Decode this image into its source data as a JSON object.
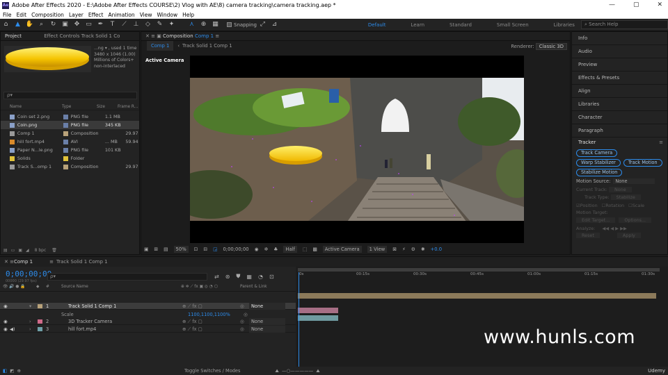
{
  "titlebar": {
    "title": "Adobe After Effects 2020 - E:\\Adobe After Effects COURSE\\2) Vlog with AE\\8) camera tracking\\camera tracking.aep *",
    "logo": "Ae"
  },
  "menu": [
    "File",
    "Edit",
    "Composition",
    "Layer",
    "Effect",
    "Animation",
    "View",
    "Window",
    "Help"
  ],
  "toolbar": {
    "snapping_label": "Snapping",
    "workspaces": [
      "Default",
      "Learn",
      "Standard",
      "Small Screen",
      "Libraries"
    ],
    "active_workspace": "Default",
    "search_placeholder": "Search Help"
  },
  "project": {
    "tab_project": "Project",
    "tab_effect_controls": "Effect Controls Track Solid 1 Co",
    "info_lines": [
      "...ng ▾ , used 1 time",
      "3480 x 1046 (1.00)",
      "",
      "Millions of Colors+",
      "non-interlaced"
    ],
    "search_placeholder": "ρ▾",
    "columns": [
      "Name",
      "Type",
      "Size",
      "Frame R..."
    ],
    "items": [
      {
        "name": "Coin set 2.png",
        "type": "PNG file",
        "size": "1.1 MB",
        "fps": "",
        "swatch": "#6a7fa8",
        "icon": "#8aa0c8",
        "selected": false
      },
      {
        "name": "Coin.png",
        "type": "PNG file",
        "size": "345 KB",
        "fps": "",
        "swatch": "#6a7fa8",
        "icon": "#8aa0c8",
        "selected": true
      },
      {
        "name": "Comp 1",
        "type": "Composition",
        "size": "",
        "fps": "29.97",
        "swatch": "#b8a27a",
        "icon": "#9a9a9a",
        "selected": false
      },
      {
        "name": "hill fort.mp4",
        "type": "AVI",
        "size": "... MB",
        "fps": "59.94",
        "swatch": "#6a7fa8",
        "icon": "#d98a2b",
        "selected": false
      },
      {
        "name": "Paper N...le.png",
        "type": "PNG file",
        "size": "101 KB",
        "fps": "",
        "swatch": "#6a7fa8",
        "icon": "#8aa0c8",
        "selected": false
      },
      {
        "name": "Solids",
        "type": "Folder",
        "size": "",
        "fps": "",
        "swatch": "#e0c23a",
        "icon": "#e0c23a",
        "selected": false
      },
      {
        "name": "Track S...omp 1",
        "type": "Composition",
        "size": "",
        "fps": "29.97",
        "swatch": "#b8a27a",
        "icon": "#9a9a9a",
        "selected": false
      }
    ],
    "bpc": "8 bpc"
  },
  "composition": {
    "tab_label": "Composition",
    "tab_comp": "Comp 1",
    "breadcrumb_1": "Comp 1",
    "breadcrumb_2": "Track Solid 1 Comp 1",
    "renderer_label": "Renderer:",
    "renderer_value": "Classic 3D",
    "active_camera": "Active Camera",
    "zoom": "50%",
    "timecode": "0;00;00;00",
    "resolution": "Half",
    "view_camera": "Active Camera",
    "views": "1 View",
    "exposure": "+0.0"
  },
  "right_panels": {
    "items": [
      "Info",
      "Audio",
      "Preview",
      "Effects & Presets",
      "Align",
      "Libraries",
      "Character",
      "Paragraph"
    ],
    "tracker_title": "Tracker",
    "buttons": [
      "Track Camera",
      "Warp Stabilizer",
      "Track Motion",
      "Stabilize Motion"
    ],
    "motion_source_label": "Motion Source:",
    "motion_source_value": "None",
    "current_track_label": "Current Track:",
    "current_track_value": "None",
    "track_type_label": "Track Type:",
    "track_type_value": "Stabilize",
    "checks": [
      "Position",
      "Rotation",
      "Scale"
    ],
    "motion_target": "Motion Target:",
    "edit_target": "Edit Target...",
    "options": "Options...",
    "analyze": "Analyze:",
    "reset": "Reset",
    "apply": "Apply"
  },
  "timeline": {
    "tab_comp": "Comp 1",
    "tab_track": "Track Solid 1 Comp 1",
    "timecode": "0;00;00;00",
    "fps": "00000 (29.97 fps)",
    "search_placeholder": "ρ▾",
    "col_source": "Source Name",
    "col_parent": "Parent & Link",
    "layers": [
      {
        "num": "1",
        "name": "Track Solid 1 Comp 1",
        "parent": "None",
        "label": "#b8a27a",
        "selected": true
      },
      {
        "num": "2",
        "name": "3D Tracker Camera",
        "parent": "None",
        "label": "#d06a8a",
        "selected": false
      },
      {
        "num": "3",
        "name": "hill fort.mp4",
        "parent": "None",
        "label": "#6fa0a8",
        "selected": false
      }
    ],
    "scale_label": "Scale",
    "scale_value": "1100,1100,1100%",
    "ruler": [
      "0s",
      "00:15s",
      "00:30s",
      "00:45s",
      "01:00s",
      "01:15s",
      "01:30s"
    ],
    "toggle_label": "Toggle Switches / Modes"
  },
  "watermark": "www.hunls.com",
  "udemy": "Udemy",
  "colors": {
    "accent": "#2d8ceb",
    "bg": "#1d1d1d",
    "panel": "#232323"
  }
}
